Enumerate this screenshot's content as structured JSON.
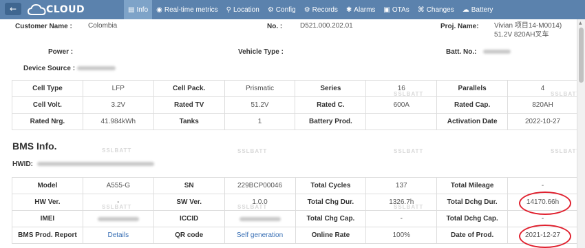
{
  "nav": {
    "back_symbol": "←",
    "logo_text": "CLOUD",
    "tabs": [
      {
        "label": "Info",
        "icon": "▤",
        "active": true
      },
      {
        "label": "Real-time metrics",
        "icon": "◉",
        "active": false
      },
      {
        "label": "Location",
        "icon": "⚲",
        "active": false
      },
      {
        "label": "Config",
        "icon": "⚙",
        "active": false
      },
      {
        "label": "Records",
        "icon": "⚙",
        "active": false
      },
      {
        "label": "Alarms",
        "icon": "✱",
        "active": false
      },
      {
        "label": "OTAs",
        "icon": "▣",
        "active": false
      },
      {
        "label": "Changes",
        "icon": "⌘",
        "active": false
      },
      {
        "label": "Battery",
        "icon": "☁",
        "active": false
      }
    ]
  },
  "info": {
    "customer_name_label": "Customer Name :",
    "customer_name": "Colombia",
    "no_label": "No. :",
    "no_value": "D521.000.202.01",
    "proj_name_label": "Proj. Name:",
    "proj_name_line1": "Vivian 项目14-M0014)",
    "proj_name_line2": "51.2V 820AH叉车",
    "power_label": "Power :",
    "vehicle_type_label": "Vehicle Type :",
    "batt_no_label": "Batt. No.:",
    "device_source_label": "Device Source :"
  },
  "specs": {
    "rows": [
      [
        "Cell Type",
        "LFP",
        "Cell Pack.",
        "Prismatic",
        "Series",
        "16",
        "Parallels",
        "4"
      ],
      [
        "Cell Volt.",
        "3.2V",
        "Rated TV",
        "51.2V",
        "Rated C.",
        "600A",
        "Rated Cap.",
        "820AH"
      ],
      [
        "Rated Nrg.",
        "41.984kWh",
        "Tanks",
        "1",
        "Battery Prod.",
        "",
        "Activation Date",
        "2022-10-27"
      ]
    ]
  },
  "bms": {
    "title": "BMS Info.",
    "hwid_label": "HWID:",
    "rows": [
      [
        "Model",
        "A555-G",
        "SN",
        "229BCP00046",
        "Total Cycles",
        "137",
        "Total Mileage",
        "-"
      ],
      [
        "HW Ver.",
        "-",
        "SW Ver.",
        "1.0.0",
        "Total Chg Dur.",
        "1326.7h",
        "Total Dchg Dur.",
        "14170.66h"
      ],
      [
        "IMEI",
        "",
        "ICCID",
        "",
        "Total Chg Cap.",
        "-",
        "Total Dchg Cap.",
        "-"
      ],
      [
        "BMS Prod. Report",
        "Details",
        "QR code",
        "Self generation",
        "Online Rate",
        "100%",
        "Date of Prod.",
        "2021-12-27"
      ]
    ]
  },
  "watermark": "SSLBATT",
  "colors": {
    "nav_bg": "#5b82ad",
    "nav_active": "#7ea3c8",
    "link": "#3a70b5",
    "highlight_circle": "#e0212f"
  }
}
